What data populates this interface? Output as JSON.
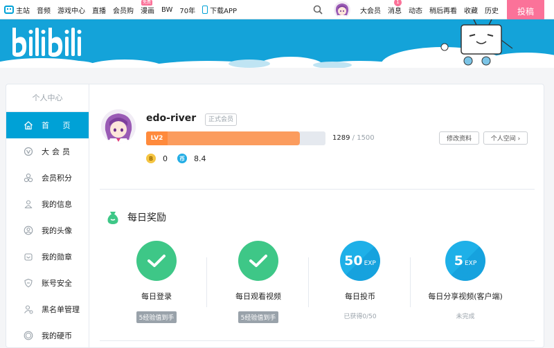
{
  "topnav": {
    "left": [
      {
        "label": "主站",
        "icon": "tv-logo-icon"
      },
      {
        "label": "音频"
      },
      {
        "label": "游戏中心"
      },
      {
        "label": "直播"
      },
      {
        "label": "会员购"
      },
      {
        "label": "漫画",
        "badge": "免费"
      },
      {
        "label": "BW"
      },
      {
        "label": "70年"
      },
      {
        "label": "下载APP",
        "icon": "phone-icon"
      }
    ],
    "right": [
      {
        "label": "大会员"
      },
      {
        "label": "消息",
        "count": "1"
      },
      {
        "label": "动态"
      },
      {
        "label": "稍后再看"
      },
      {
        "label": "收藏"
      },
      {
        "label": "历史"
      }
    ],
    "upload_label": "投稿"
  },
  "banner": {
    "logo_text": "bilibili"
  },
  "sidebar": {
    "title": "个人中心",
    "items": [
      {
        "label": "首 页",
        "icon": "home-icon",
        "active": true
      },
      {
        "label": "大会员",
        "icon": "vip-icon"
      },
      {
        "label": "会员积分",
        "icon": "points-icon"
      },
      {
        "label": "我的信息",
        "icon": "user-info-icon"
      },
      {
        "label": "我的头像",
        "icon": "avatar-icon"
      },
      {
        "label": "我的勋章",
        "icon": "medal-icon"
      },
      {
        "label": "账号安全",
        "icon": "shield-icon"
      },
      {
        "label": "黑名单管理",
        "icon": "blacklist-icon"
      },
      {
        "label": "我的硬币",
        "icon": "coin-icon"
      }
    ]
  },
  "profile": {
    "username": "edo-river",
    "vip_tag": "正式会员",
    "level": "LV2",
    "exp_current": "1289",
    "exp_sep": "/",
    "exp_max": "1500",
    "exp_fraction": 0.859,
    "b_coin_symbol": "B",
    "b_coin": "0",
    "coin_symbol": "币",
    "coins": "8.4",
    "edit_label": "修改资料",
    "space_label": "个人空间 ›"
  },
  "daily": {
    "title": "每日奖励",
    "tasks": [
      {
        "label": "每日登录",
        "status": "5经验值到手",
        "done": true
      },
      {
        "label": "每日观看视频",
        "status": "5经验值到手",
        "done": true
      },
      {
        "label": "每日投币",
        "status": "已获得0/50",
        "exp": "50",
        "exp_unit": "EXP",
        "done": false
      },
      {
        "label": "每日分享视频(客户端)",
        "status": "未完成",
        "exp": "5",
        "exp_unit": "EXP",
        "done": false
      }
    ]
  },
  "colors": {
    "accent": "#00a1d6",
    "pink": "#fb7299",
    "green": "#3ec787",
    "orange": "#fb9c5e"
  }
}
